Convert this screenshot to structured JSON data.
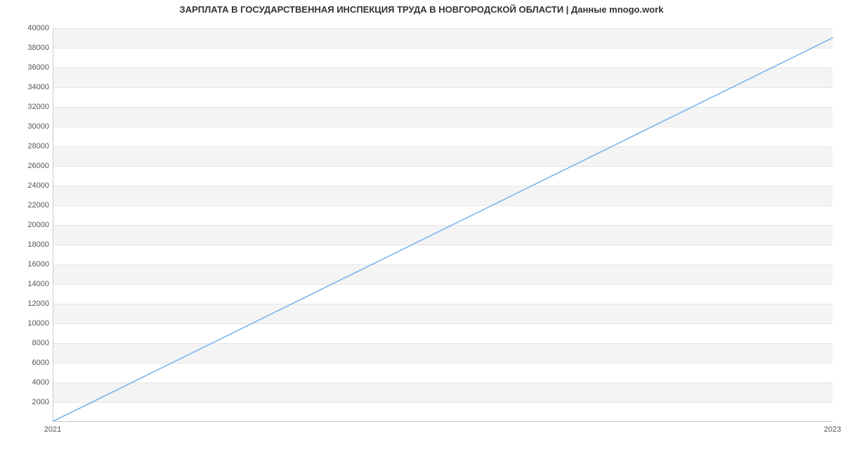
{
  "chart_data": {
    "type": "line",
    "title": "ЗАРПЛАТА В ГОСУДАРСТВЕННАЯ ИНСПЕКЦИЯ ТРУДА В НОВГОРОДСКОЙ ОБЛАСТИ | Данные mnogo.work",
    "xlabel": "",
    "ylabel": "",
    "x": [
      2021,
      2023
    ],
    "values": [
      0,
      39000
    ],
    "xlim": [
      2021,
      2023
    ],
    "ylim": [
      0,
      40000
    ],
    "x_ticks": [
      2021,
      2023
    ],
    "y_ticks": [
      2000,
      4000,
      6000,
      8000,
      10000,
      12000,
      14000,
      16000,
      18000,
      20000,
      22000,
      24000,
      26000,
      28000,
      30000,
      32000,
      34000,
      36000,
      38000,
      40000
    ],
    "grid": true,
    "series_color": "#7cb5ec"
  }
}
